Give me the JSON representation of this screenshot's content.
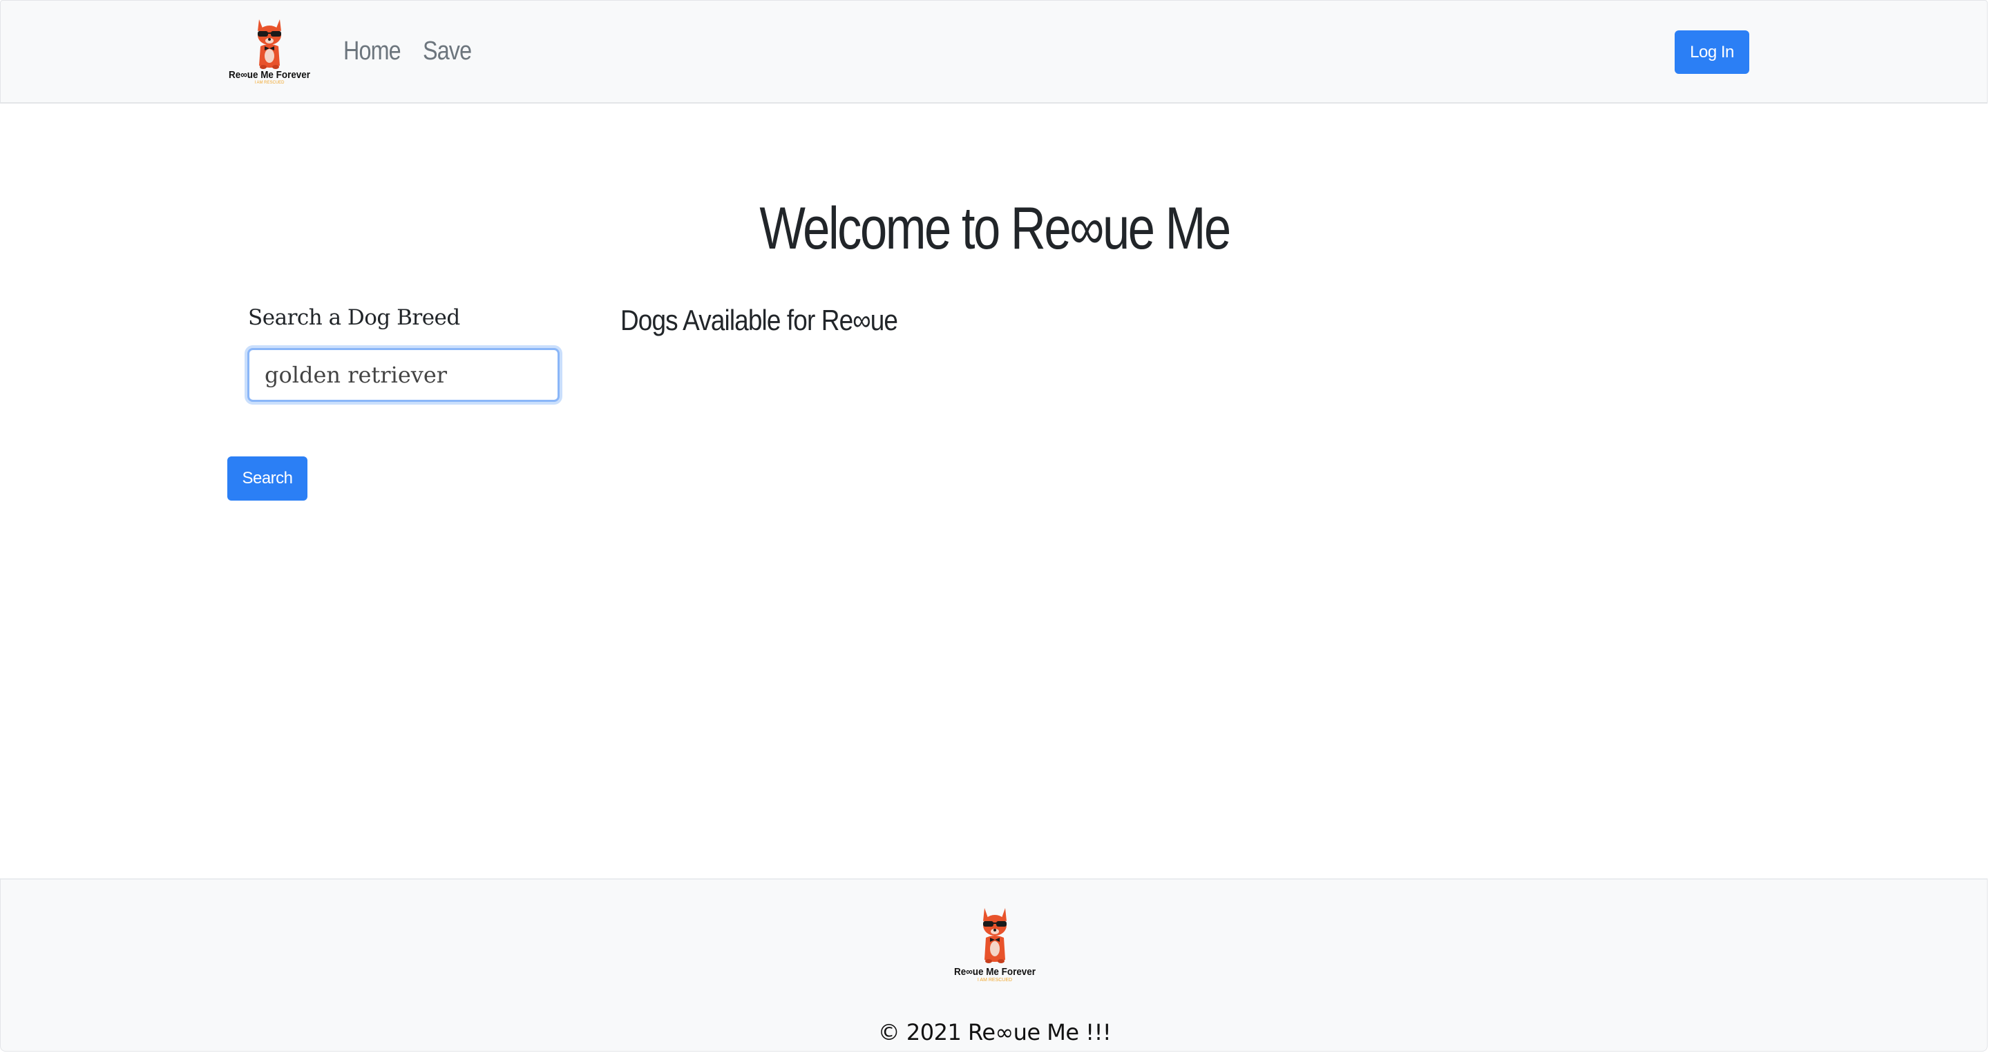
{
  "header": {
    "logo_text": "Re∞ue Me Forever",
    "logo_subtext": "I AM RESCUED",
    "nav": {
      "home": "Home",
      "save": "Save"
    },
    "login_label": "Log In"
  },
  "main": {
    "title": "Welcome to Re∞ue Me",
    "search": {
      "label": "Search a Dog Breed",
      "value": "golden retriever",
      "button_label": "Search"
    },
    "dogs_heading": "Dogs Available for Re∞ue"
  },
  "footer": {
    "logo_text": "Re∞ue Me Forever",
    "logo_subtext": "I AM RESCUED",
    "copyright": "© 2021 Re∞ue Me !!!"
  },
  "colors": {
    "primary": "#2b7ff5",
    "navbar_bg": "#f8f9fa",
    "logo_dog": "#e8532b",
    "logo_subtext": "#f0a830"
  }
}
